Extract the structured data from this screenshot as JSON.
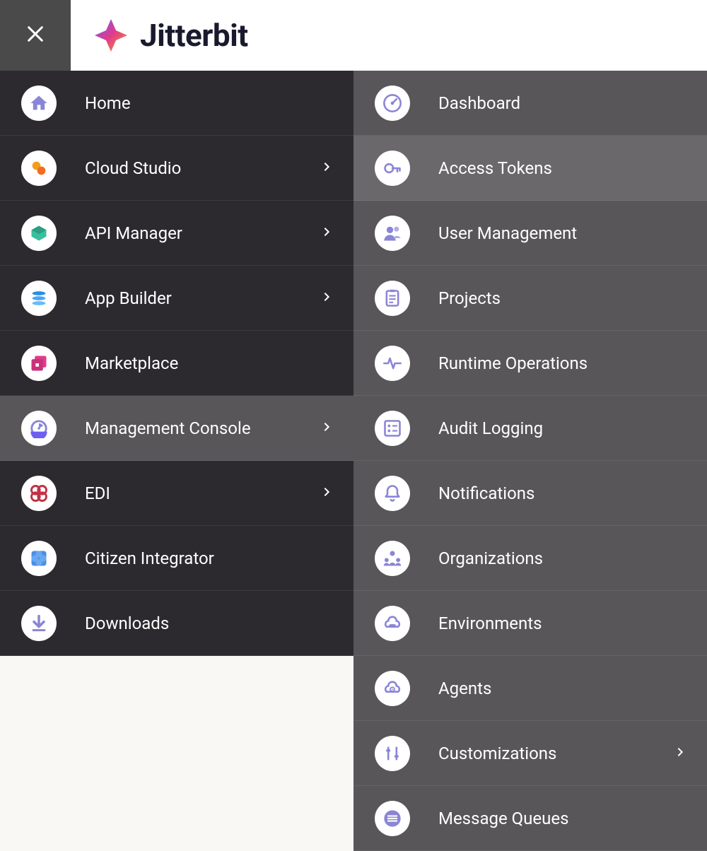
{
  "brand": {
    "name": "Jitterbit"
  },
  "left_nav": {
    "items": [
      {
        "label": "Home",
        "icon": "home-icon",
        "expandable": false,
        "active": false
      },
      {
        "label": "Cloud Studio",
        "icon": "cloud-studio-icon",
        "expandable": true,
        "active": false
      },
      {
        "label": "API Manager",
        "icon": "api-manager-icon",
        "expandable": true,
        "active": false
      },
      {
        "label": "App Builder",
        "icon": "app-builder-icon",
        "expandable": true,
        "active": false
      },
      {
        "label": "Marketplace",
        "icon": "marketplace-icon",
        "expandable": false,
        "active": false
      },
      {
        "label": "Management Console",
        "icon": "management-console-icon",
        "expandable": true,
        "active": true
      },
      {
        "label": "EDI",
        "icon": "edi-icon",
        "expandable": true,
        "active": false
      },
      {
        "label": "Citizen Integrator",
        "icon": "citizen-integrator-icon",
        "expandable": false,
        "active": false
      },
      {
        "label": "Downloads",
        "icon": "downloads-icon",
        "expandable": false,
        "active": false
      }
    ]
  },
  "right_nav": {
    "items": [
      {
        "label": "Dashboard",
        "icon": "dashboard-icon",
        "expandable": false,
        "highlight": false
      },
      {
        "label": "Access Tokens",
        "icon": "access-tokens-icon",
        "expandable": false,
        "highlight": true
      },
      {
        "label": "User Management",
        "icon": "user-management-icon",
        "expandable": false,
        "highlight": false
      },
      {
        "label": "Projects",
        "icon": "projects-icon",
        "expandable": false,
        "highlight": false
      },
      {
        "label": "Runtime Operations",
        "icon": "runtime-operations-icon",
        "expandable": false,
        "highlight": false
      },
      {
        "label": "Audit Logging",
        "icon": "audit-logging-icon",
        "expandable": false,
        "highlight": false
      },
      {
        "label": "Notifications",
        "icon": "notifications-icon",
        "expandable": false,
        "highlight": false
      },
      {
        "label": "Organizations",
        "icon": "organizations-icon",
        "expandable": false,
        "highlight": false
      },
      {
        "label": "Environments",
        "icon": "environments-icon",
        "expandable": false,
        "highlight": false
      },
      {
        "label": "Agents",
        "icon": "agents-icon",
        "expandable": false,
        "highlight": false
      },
      {
        "label": "Customizations",
        "icon": "customizations-icon",
        "expandable": true,
        "highlight": false
      },
      {
        "label": "Message Queues",
        "icon": "message-queues-icon",
        "expandable": false,
        "highlight": false
      }
    ]
  }
}
